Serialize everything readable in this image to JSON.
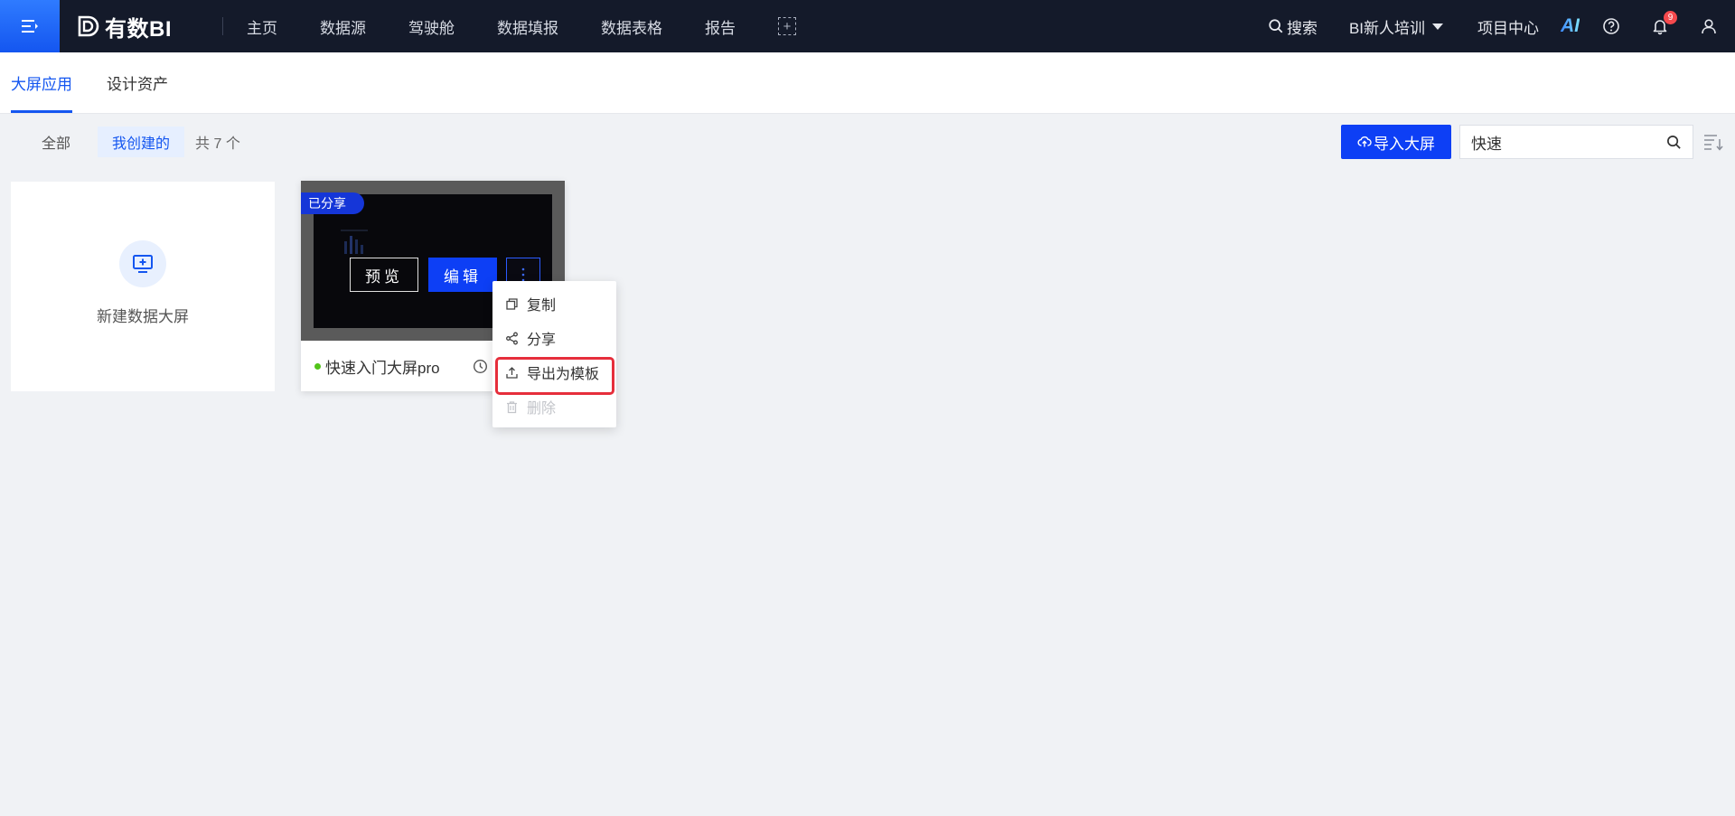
{
  "topbar": {
    "brand": "有数BI",
    "nav": [
      "主页",
      "数据源",
      "驾驶舱",
      "数据填报",
      "数据表格",
      "报告"
    ],
    "search_label": "搜索",
    "project": "BI新人培训",
    "project_center": "项目中心",
    "ai_label": "AI",
    "notification_count": "9",
    "accent": "#1456f0"
  },
  "subtabs": [
    "大屏应用",
    "设计资产"
  ],
  "filters": {
    "all": "全部",
    "mine": "我创建的",
    "total": "共 7 个",
    "import_button": "导入大屏",
    "search_value": "快速"
  },
  "new_card": {
    "label": "新建数据大屏"
  },
  "screen_card": {
    "shared_tag": "已分享",
    "preview": "预览",
    "edit": "编辑",
    "name": "快速入门大屏pro",
    "status_color": "#52c41a"
  },
  "dropdown": {
    "items": [
      {
        "label": "复制",
        "icon": "copy-icon"
      },
      {
        "label": "分享",
        "icon": "share-icon"
      },
      {
        "label": "导出为模板",
        "icon": "export-icon"
      },
      {
        "label": "删除",
        "icon": "delete-icon"
      }
    ]
  }
}
